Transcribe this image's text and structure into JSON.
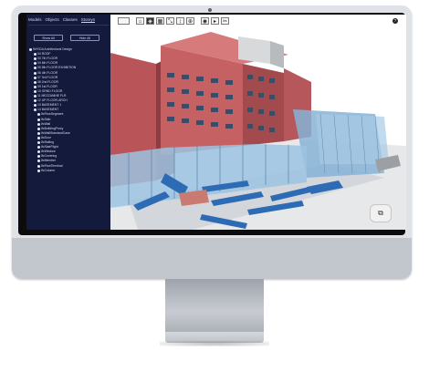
{
  "sidebar": {
    "tabs": [
      {
        "label": "Models",
        "active": false
      },
      {
        "label": "Objects",
        "active": false
      },
      {
        "label": "Classes",
        "active": false
      },
      {
        "label": "Storeys",
        "active": true
      }
    ],
    "buttons": {
      "show_all": "Show All",
      "hide_all": "Hide All"
    },
    "tree": [
      {
        "label": "NHYDA Architectural Design",
        "level": 0
      },
      {
        "label": "04 ROOF",
        "level": 1
      },
      {
        "label": "03 7th FLOOR",
        "level": 1
      },
      {
        "label": "04 6th FLOOR",
        "level": 1
      },
      {
        "label": "05 5th FLOOR EXHIBITION",
        "level": 1
      },
      {
        "label": "06 4th FLOOR",
        "level": 1
      },
      {
        "label": "07 3rd FLOOR",
        "level": 1
      },
      {
        "label": "08 2nd FLOOR",
        "level": 1
      },
      {
        "label": "09 1st FLOOR",
        "level": 1
      },
      {
        "label": "10 GRND FLOOR",
        "level": 1
      },
      {
        "label": "11 MEZZANINE FLR",
        "level": 1
      },
      {
        "label": "12 UP FLOOR-ARCH",
        "level": 1
      },
      {
        "label": "13 BASEMENT 1",
        "level": 1
      },
      {
        "label": "14 BASEMENT",
        "level": 1
      },
      {
        "label": "IfcFlowSegment",
        "level": 2
      },
      {
        "label": "IfcSlab",
        "level": 2
      },
      {
        "label": "IfcWall",
        "level": 2
      },
      {
        "label": "IfcBuildingProxy",
        "level": 2
      },
      {
        "label": "IfcWallStandardCase",
        "level": 2
      },
      {
        "label": "IfcDoor",
        "level": 2
      },
      {
        "label": "IfcRailing",
        "level": 2
      },
      {
        "label": "IfcStairFlight",
        "level": 2
      },
      {
        "label": "IfcWindow",
        "level": 2
      },
      {
        "label": "IfcCovering",
        "level": 2
      },
      {
        "label": "IfcMember",
        "level": 2
      },
      {
        "label": "IfcFlowTerminal",
        "level": 2
      },
      {
        "label": "IfcColumn",
        "level": 2
      }
    ]
  },
  "toolbar": {
    "buttons": [
      {
        "icon": "blank",
        "symbol": ""
      },
      {
        "icon": "home-icon",
        "symbol": "⌂"
      },
      {
        "icon": "cube-icon",
        "symbol": "◈"
      },
      {
        "icon": "grid-icon",
        "symbol": "▦"
      },
      {
        "icon": "fit-icon",
        "symbol": "⤡"
      },
      {
        "icon": "ruler-icon",
        "symbol": "↕"
      },
      {
        "icon": "orbit-icon",
        "symbol": "⊕"
      },
      {
        "icon": "eye-icon",
        "symbol": "◉"
      },
      {
        "icon": "select-icon",
        "symbol": "▸"
      },
      {
        "icon": "measure-icon",
        "symbol": "✂"
      }
    ],
    "help_symbol": "?"
  },
  "navcube": {
    "symbol": "⧉"
  }
}
